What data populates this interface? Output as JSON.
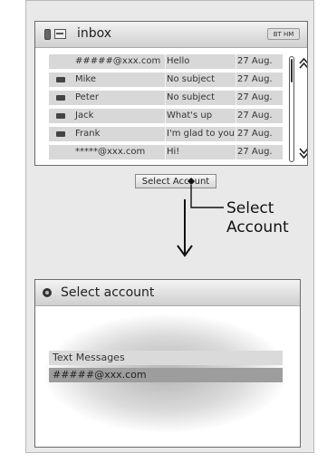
{
  "screen1": {
    "title": "inbox",
    "status_badge": "BT HM",
    "messages": [
      {
        "sender": "#####@xxx.com",
        "subject": "Hello",
        "date": "27 Aug."
      },
      {
        "sender": "Mike",
        "subject": "No subject",
        "date": "27 Aug."
      },
      {
        "sender": "Peter",
        "subject": "No subject",
        "date": "27 Aug."
      },
      {
        "sender": "Jack",
        "subject": "What's up",
        "date": "27 Aug."
      },
      {
        "sender": "Frank",
        "subject": "I'm glad to you",
        "date": "27 Aug."
      },
      {
        "sender": "*****@xxx.com",
        "subject": "Hi!",
        "date": "27 Aug."
      }
    ],
    "select_button": "Select Account"
  },
  "callout": {
    "line1": "Select",
    "line2": "Account"
  },
  "screen2": {
    "title": "Select account",
    "accounts": [
      "Text Messages",
      "#####@xxx.com"
    ]
  },
  "colors": {
    "row_bg": "#d8d8d8",
    "selected_row": "#9d9d9d",
    "panel_bg": "#e9e9e9"
  }
}
